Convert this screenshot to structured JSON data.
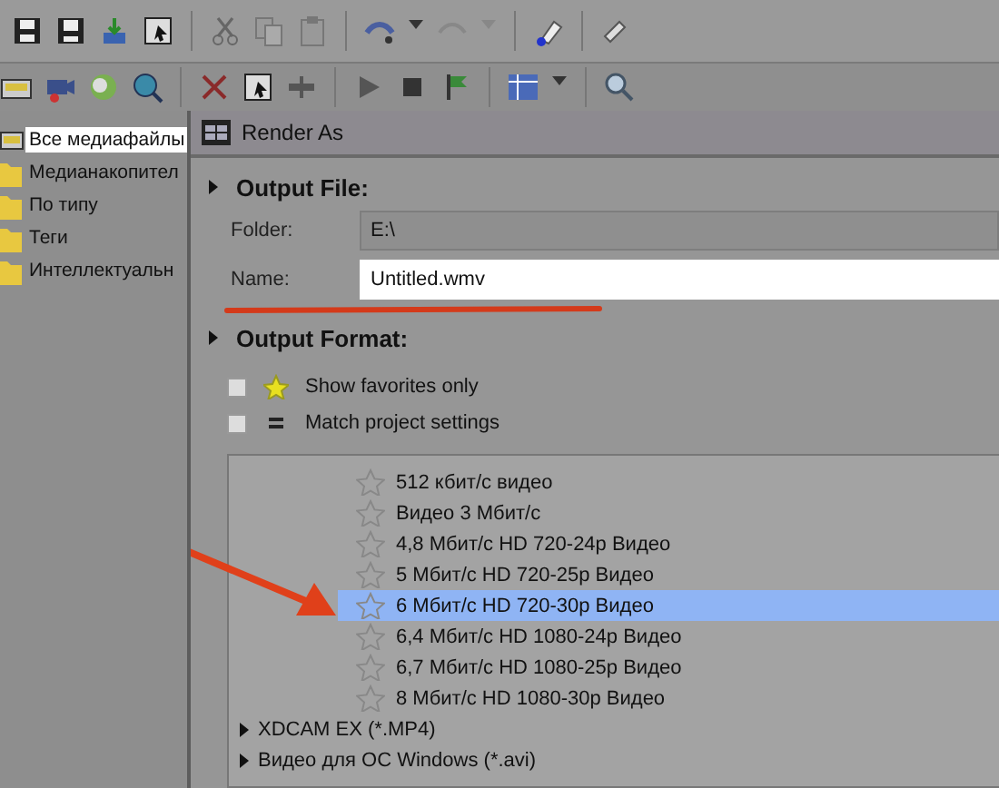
{
  "tree": {
    "items": [
      {
        "label": "Все медиафайлы",
        "selected": true,
        "kind": "media"
      },
      {
        "label": "Медианакопител",
        "selected": false,
        "kind": "folder"
      },
      {
        "label": "По типу",
        "selected": false,
        "kind": "folder"
      },
      {
        "label": "Теги",
        "selected": false,
        "kind": "folder"
      },
      {
        "label": "Интеллектуальн",
        "selected": false,
        "kind": "folder"
      }
    ]
  },
  "dialog": {
    "title": "Render As",
    "output_file": {
      "heading": "Output File:",
      "folder_label": "Folder:",
      "folder_value": "E:\\",
      "name_label": "Name:",
      "name_value": "Untitled.wmv"
    },
    "output_format": {
      "heading": "Output Format:",
      "options": [
        {
          "label": "Show favorites only",
          "checked": false,
          "kind": "star"
        },
        {
          "label": "Match project settings",
          "checked": false,
          "kind": "equals"
        }
      ],
      "templates": [
        {
          "label": "512 кбит/с видео",
          "selected": false,
          "kind": "template"
        },
        {
          "label": "Видео 3 Мбит/с",
          "selected": false,
          "kind": "template"
        },
        {
          "label": "4,8 Мбит/с HD 720-24p Видео",
          "selected": false,
          "kind": "template"
        },
        {
          "label": "5 Мбит/с HD 720-25p Видео",
          "selected": false,
          "kind": "template"
        },
        {
          "label": "6 Мбит/с HD 720-30p Видео",
          "selected": true,
          "kind": "template"
        },
        {
          "label": "6,4 Мбит/с HD 1080-24p Видео",
          "selected": false,
          "kind": "template"
        },
        {
          "label": "6,7 Мбит/с HD 1080-25p Видео",
          "selected": false,
          "kind": "template"
        },
        {
          "label": "8 Мбит/с HD 1080-30p Видео",
          "selected": false,
          "kind": "template"
        },
        {
          "label": "XDCAM EX (*.MP4)",
          "selected": false,
          "kind": "group"
        },
        {
          "label": "Видео для ОС Windows (*.avi)",
          "selected": false,
          "kind": "group"
        }
      ]
    }
  }
}
